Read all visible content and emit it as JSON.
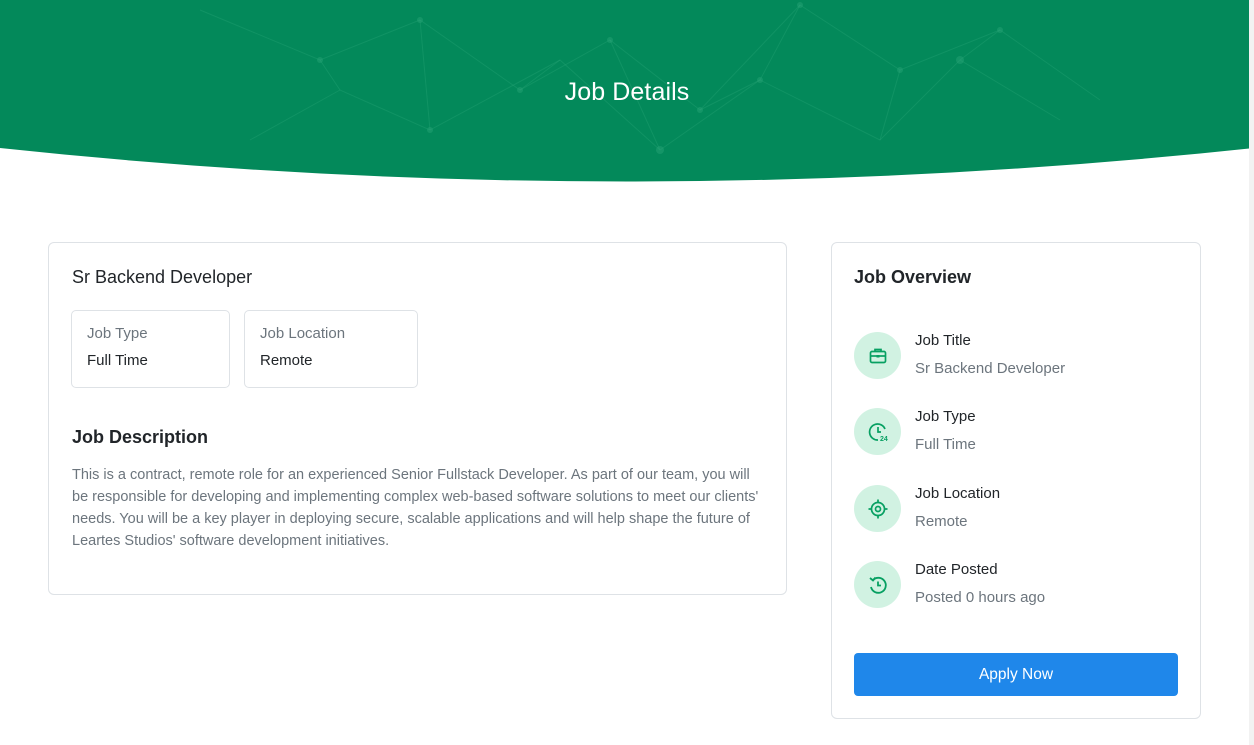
{
  "header": {
    "title": "Job Details"
  },
  "job": {
    "title": "Sr Backend Developer",
    "type_label": "Job Type",
    "type_value": "Full Time",
    "location_label": "Job Location",
    "location_value": "Remote",
    "description_heading": "Job Description",
    "description": "This is a contract, remote role for an experienced Senior Fullstack Developer. As part of our team, you will be responsible for developing and implementing complex web-based software solutions to meet our clients' needs. You will be a key player in deploying secure, scalable applications and will help shape the future of Leartes Studios' software development initiatives."
  },
  "overview": {
    "heading": "Job Overview",
    "items": [
      {
        "icon": "briefcase-icon",
        "label": "Job Title",
        "value": "Sr Backend Developer"
      },
      {
        "icon": "clock-24-icon",
        "label": "Job Type",
        "value": "Full Time"
      },
      {
        "icon": "location-target-icon",
        "label": "Job Location",
        "value": "Remote"
      },
      {
        "icon": "history-icon",
        "label": "Date Posted",
        "value": "Posted 0 hours ago"
      }
    ],
    "apply_label": "Apply Now"
  },
  "colors": {
    "header_green": "#03895a",
    "icon_green": "#07a062",
    "icon_bg": "#d1f2e2",
    "button_blue": "#1f87ea"
  }
}
